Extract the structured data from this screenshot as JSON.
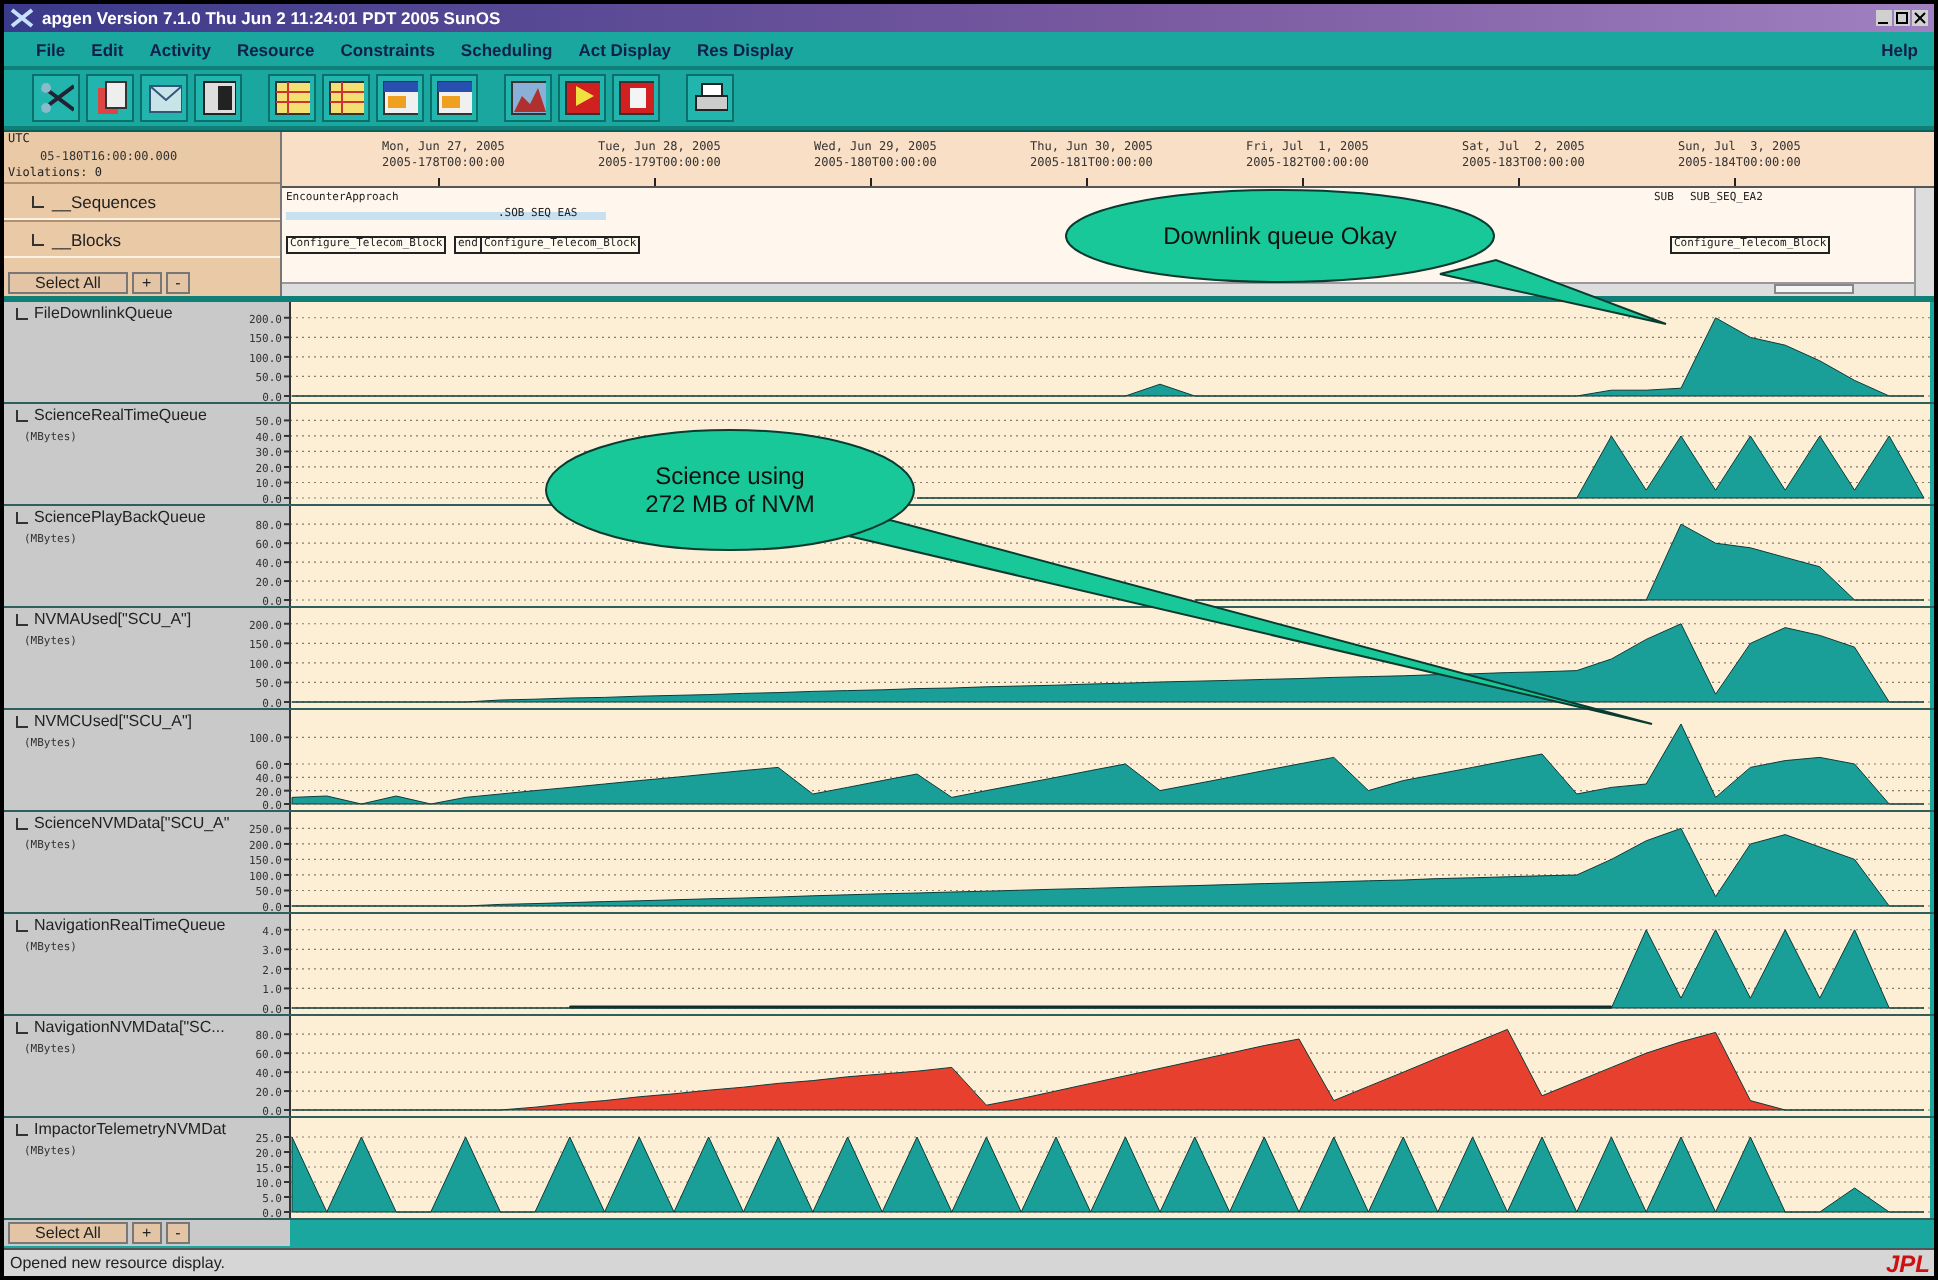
{
  "window": {
    "title": "apgen Version 7.1.0  Thu Jun 2 11:24:01 PDT 2005  SunOS"
  },
  "menu": [
    "File",
    "Edit",
    "Activity",
    "Resource",
    "Constraints",
    "Scheduling",
    "Act Display",
    "Res Display"
  ],
  "help_menu": "Help",
  "header": {
    "utc_label": "UTC",
    "time": "05-180T16:00:00.000",
    "violations": "Violations: 0"
  },
  "legend_rows": [
    {
      "label": "__Sequences",
      "checked": false
    },
    {
      "label": "__Blocks",
      "checked": false
    }
  ],
  "select_rows": [
    {
      "select_all": "Select All",
      "buttons": [
        "+",
        "-"
      ]
    },
    {
      "select_all": "Select All",
      "buttons": [
        "+",
        "-"
      ]
    }
  ],
  "timeline": {
    "dates": [
      {
        "day": "Mon, Jun 27, 2005",
        "doy": "2005-178T00:00:00"
      },
      {
        "day": "Tue, Jun 28, 2005",
        "doy": "2005-179T00:00:00"
      },
      {
        "day": "Wed, Jun 29, 2005",
        "doy": "2005-180T00:00:00"
      },
      {
        "day": "Thu, Jun 30, 2005",
        "doy": "2005-181T00:00:00"
      },
      {
        "day": "Fri, Jul  1, 2005",
        "doy": "2005-182T00:00:00"
      },
      {
        "day": "Sat, Jul  2, 2005",
        "doy": "2005-183T00:00:00"
      },
      {
        "day": "Sun, Jul  3, 2005",
        "doy": "2005-184T00:00:00"
      }
    ],
    "activities": [
      {
        "kind": "sequence",
        "label": "EncounterApproach"
      },
      {
        "kind": "sequence",
        "label": ".SOB SEQ EAS"
      },
      {
        "kind": "sequence",
        "label": "SUB"
      },
      {
        "kind": "sequence",
        "label": "SUB_SEQ_EA2"
      },
      {
        "kind": "block",
        "label": "Configure_Telecom_Block"
      },
      {
        "kind": "block",
        "label": "end"
      },
      {
        "kind": "block",
        "label": "Configure_Telecom_Block"
      },
      {
        "kind": "block",
        "label": "Configure_Telecom_Block"
      }
    ]
  },
  "panels": [
    {
      "name": "FileDownlinkQueue",
      "checked": false,
      "chart_data": {
        "type": "area",
        "grid": true,
        "ylim": [
          0,
          230
        ],
        "yticks": [
          {
            "value": 0,
            "label": "0.0"
          },
          {
            "value": 50,
            "label": "50.0"
          },
          {
            "value": 100,
            "label": "100.0"
          },
          {
            "value": 150,
            "label": "150.0"
          },
          {
            "value": 200,
            "label": "200.0"
          }
        ],
        "series": [
          {
            "color": "#1a9e98",
            "values": [
              0,
              0,
              0,
              0,
              0,
              0,
              0,
              0,
              0,
              0,
              0,
              0,
              0,
              0,
              0,
              0,
              0,
              0,
              0,
              0,
              0,
              0,
              0,
              0,
              0,
              30,
              0,
              0,
              0,
              0,
              0,
              0,
              0,
              0,
              0,
              0,
              0,
              0,
              15,
              15,
              20,
              200,
              150,
              130,
              90,
              40,
              0,
              0
            ]
          }
        ]
      }
    },
    {
      "name": "ScienceRealTimeQueue",
      "checked": false,
      "unit": "(MBytes)",
      "chart_data": {
        "type": "area",
        "grid": true,
        "ylim": [
          0,
          58
        ],
        "yticks": [
          {
            "value": 0,
            "label": "0.0"
          },
          {
            "value": 10,
            "label": "10.0"
          },
          {
            "value": 20,
            "label": "20.0"
          },
          {
            "value": 30,
            "label": "30.0"
          },
          {
            "value": 40,
            "label": "40.0"
          },
          {
            "value": 50,
            "label": "50.0"
          }
        ],
        "series": [
          {
            "color": "#1a9e98",
            "values": [
              null,
              null,
              null,
              null,
              null,
              null,
              null,
              null,
              null,
              null,
              null,
              null,
              null,
              null,
              null,
              null,
              null,
              null,
              0,
              0,
              0,
              0,
              0,
              0,
              0,
              0,
              0,
              0,
              0,
              0,
              0,
              0,
              0,
              0,
              0,
              0,
              0,
              0,
              40,
              5,
              40,
              5,
              40,
              5,
              40,
              5,
              40,
              0
            ]
          }
        ]
      }
    },
    {
      "name": "SciencePlayBackQueue",
      "checked": false,
      "unit": "(MBytes)",
      "chart_data": {
        "type": "area",
        "grid": true,
        "ylim": [
          0,
          95
        ],
        "yticks": [
          {
            "value": 0,
            "label": "0.0"
          },
          {
            "value": 20,
            "label": "20.0"
          },
          {
            "value": 40,
            "label": "40.0"
          },
          {
            "value": 60,
            "label": "60.0"
          },
          {
            "value": 80,
            "label": "80.0"
          }
        ],
        "series": [
          {
            "color": "#1a9e98",
            "values": [
              null,
              null,
              null,
              null,
              null,
              null,
              null,
              null,
              null,
              null,
              null,
              null,
              null,
              null,
              null,
              null,
              null,
              null,
              null,
              null,
              null,
              null,
              null,
              null,
              null,
              null,
              0,
              0,
              0,
              0,
              0,
              0,
              0,
              0,
              0,
              0,
              0,
              0,
              0,
              0,
              80,
              60,
              55,
              45,
              35,
              0,
              0,
              0
            ]
          }
        ]
      }
    },
    {
      "name": "NVMAUsed[\"SCU_A\"]",
      "checked": false,
      "unit": "(MBytes)",
      "chart_data": {
        "type": "area",
        "grid": true,
        "ylim": [
          0,
          230
        ],
        "yticks": [
          {
            "value": 0,
            "label": "0.0"
          },
          {
            "value": 50,
            "label": "50.0"
          },
          {
            "value": 100,
            "label": "100.0"
          },
          {
            "value": 150,
            "label": "150.0"
          },
          {
            "value": 200,
            "label": "200.0"
          }
        ],
        "series": [
          {
            "color": "#1a9e98",
            "values": [
              0,
              0,
              0,
              0,
              0,
              0,
              5,
              7,
              10,
              12,
              15,
              17,
              19,
              22,
              24,
              27,
              29,
              31,
              34,
              36,
              39,
              41,
              43,
              46,
              48,
              51,
              53,
              55,
              58,
              60,
              63,
              65,
              67,
              70,
              72,
              75,
              77,
              80,
              110,
              160,
              200,
              20,
              150,
              190,
              170,
              140,
              0,
              0
            ]
          }
        ]
      }
    },
    {
      "name": "NVMCUsed[\"SCU_A\"]",
      "checked": false,
      "unit": "(MBytes)",
      "chart_data": {
        "type": "area",
        "grid": true,
        "ylim": [
          0,
          135
        ],
        "yticks": [
          {
            "value": 0,
            "label": "0.0"
          },
          {
            "value": 20,
            "label": "20.0"
          },
          {
            "value": 40,
            "label": "40.0"
          },
          {
            "value": 60,
            "label": "60.0"
          },
          {
            "value": 100,
            "label": "100.0"
          }
        ],
        "series": [
          {
            "color": "#1a9e98",
            "values": [
              10,
              12,
              0,
              12,
              0,
              10,
              15,
              20,
              25,
              30,
              35,
              40,
              45,
              50,
              55,
              15,
              25,
              35,
              45,
              10,
              20,
              30,
              40,
              50,
              60,
              20,
              30,
              40,
              50,
              60,
              70,
              20,
              35,
              45,
              55,
              65,
              75,
              15,
              25,
              30,
              120,
              10,
              55,
              65,
              70,
              60,
              0,
              0
            ]
          }
        ]
      }
    },
    {
      "name": "ScienceNVMData[\"SCU_A\"",
      "checked": false,
      "unit": "(MBytes)",
      "chart_data": {
        "type": "area",
        "grid": true,
        "ylim": [
          0,
          290
        ],
        "yticks": [
          {
            "value": 0,
            "label": "0.0"
          },
          {
            "value": 50,
            "label": "50.0"
          },
          {
            "value": 100,
            "label": "100.0"
          },
          {
            "value": 150,
            "label": "150.0"
          },
          {
            "value": 200,
            "label": "200.0"
          },
          {
            "value": 250,
            "label": "250.0"
          }
        ],
        "series": [
          {
            "color": "#1a9e98",
            "values": [
              0,
              0,
              0,
              0,
              0,
              0,
              5,
              8,
              11,
              14,
              17,
              20,
              23,
              26,
              29,
              33,
              36,
              39,
              42,
              45,
              48,
              51,
              54,
              57,
              60,
              63,
              66,
              69,
              72,
              75,
              78,
              81,
              84,
              88,
              91,
              94,
              97,
              100,
              150,
              210,
              250,
              30,
              200,
              230,
              190,
              150,
              0,
              0
            ]
          }
        ]
      }
    },
    {
      "name": "NavigationRealTimeQueue",
      "checked": false,
      "unit": "(MBytes)",
      "chart_data": {
        "type": "area",
        "grid": true,
        "ylim": [
          0,
          4.6
        ],
        "yticks": [
          {
            "value": 0,
            "label": "0.0"
          },
          {
            "value": 1,
            "label": "1.0"
          },
          {
            "value": 2,
            "label": "2.0"
          },
          {
            "value": 3,
            "label": "3.0"
          },
          {
            "value": 4,
            "label": "4.0"
          }
        ],
        "series": [
          {
            "color": "#1a1a1a",
            "values": [
              null,
              null,
              null,
              null,
              null,
              null,
              null,
              null,
              0.1,
              0.1,
              0.1,
              0.1,
              0.1,
              0.1,
              0.1,
              0.1,
              0.1,
              0.1,
              0.1,
              0.1,
              0.1,
              0.1,
              0.1,
              0.1,
              0.1,
              0.1,
              0.1,
              0.1,
              0.1,
              0.1,
              0.1,
              0.1,
              0.1,
              0.1,
              0.1,
              0.1,
              0.1,
              0.1,
              0.1,
              null,
              null,
              null,
              null,
              null,
              null,
              null,
              null,
              null
            ]
          },
          {
            "color": "#1a9e98",
            "values": [
              0,
              0,
              0,
              0,
              0,
              0,
              0,
              0,
              0,
              0,
              0,
              0,
              0,
              0,
              0,
              0,
              0,
              0,
              0,
              0,
              0,
              0,
              0,
              0,
              0,
              0,
              0,
              0,
              0,
              0,
              0,
              0,
              0,
              0,
              0,
              0,
              0,
              0,
              0,
              4,
              0.5,
              4,
              0.5,
              4,
              0.5,
              4,
              0,
              0
            ]
          }
        ]
      }
    },
    {
      "name": "NavigationNVMData[\"SC...",
      "checked": false,
      "unit": "(MBytes)",
      "chart_data": {
        "type": "area",
        "grid": true,
        "ylim": [
          0,
          95
        ],
        "yticks": [
          {
            "value": 0,
            "label": "0.0"
          },
          {
            "value": 20,
            "label": "20.0"
          },
          {
            "value": 40,
            "label": "40.0"
          },
          {
            "value": 60,
            "label": "60.0"
          },
          {
            "value": 80,
            "label": "80.0"
          }
        ],
        "series": [
          {
            "color": "#e8402f",
            "values": [
              0,
              0,
              0,
              0,
              0,
              0,
              0,
              3,
              7,
              10,
              14,
              17,
              21,
              24,
              28,
              31,
              35,
              38,
              41,
              45,
              5,
              12,
              20,
              28,
              36,
              44,
              52,
              60,
              68,
              75,
              10,
              25,
              40,
              55,
              70,
              85,
              15,
              30,
              45,
              60,
              72,
              82,
              10,
              0,
              0,
              0,
              0,
              0
            ]
          }
        ]
      }
    },
    {
      "name": "ImpactorTelemetryNVMDat",
      "checked": false,
      "unit": "(MBytes)",
      "chart_data": {
        "type": "area",
        "grid": true,
        "ylim": [
          0,
          30
        ],
        "yticks": [
          {
            "value": 0,
            "label": "0.0"
          },
          {
            "value": 5,
            "label": "5.0"
          },
          {
            "value": 10,
            "label": "10.0"
          },
          {
            "value": 15,
            "label": "15.0"
          },
          {
            "value": 20,
            "label": "20.0"
          },
          {
            "value": 25,
            "label": "25.0"
          }
        ],
        "series": [
          {
            "color": "#1a9e98",
            "values": [
              25,
              0,
              25,
              0,
              0,
              25,
              0,
              0,
              25,
              0,
              25,
              0,
              25,
              0,
              25,
              0,
              25,
              0,
              25,
              0,
              25,
              0,
              25,
              0,
              25,
              0,
              25,
              0,
              25,
              0,
              25,
              0,
              25,
              0,
              25,
              0,
              25,
              0,
              25,
              0,
              25,
              0,
              25,
              0,
              0,
              8,
              0,
              0
            ]
          }
        ]
      }
    }
  ],
  "callouts": [
    {
      "lines": [
        "Downlink queue Okay"
      ]
    },
    {
      "lines": [
        "Science using",
        "272 MB of NVM"
      ]
    }
  ],
  "status_bar": {
    "message": "Opened new resource display.",
    "logo": "JPL"
  }
}
